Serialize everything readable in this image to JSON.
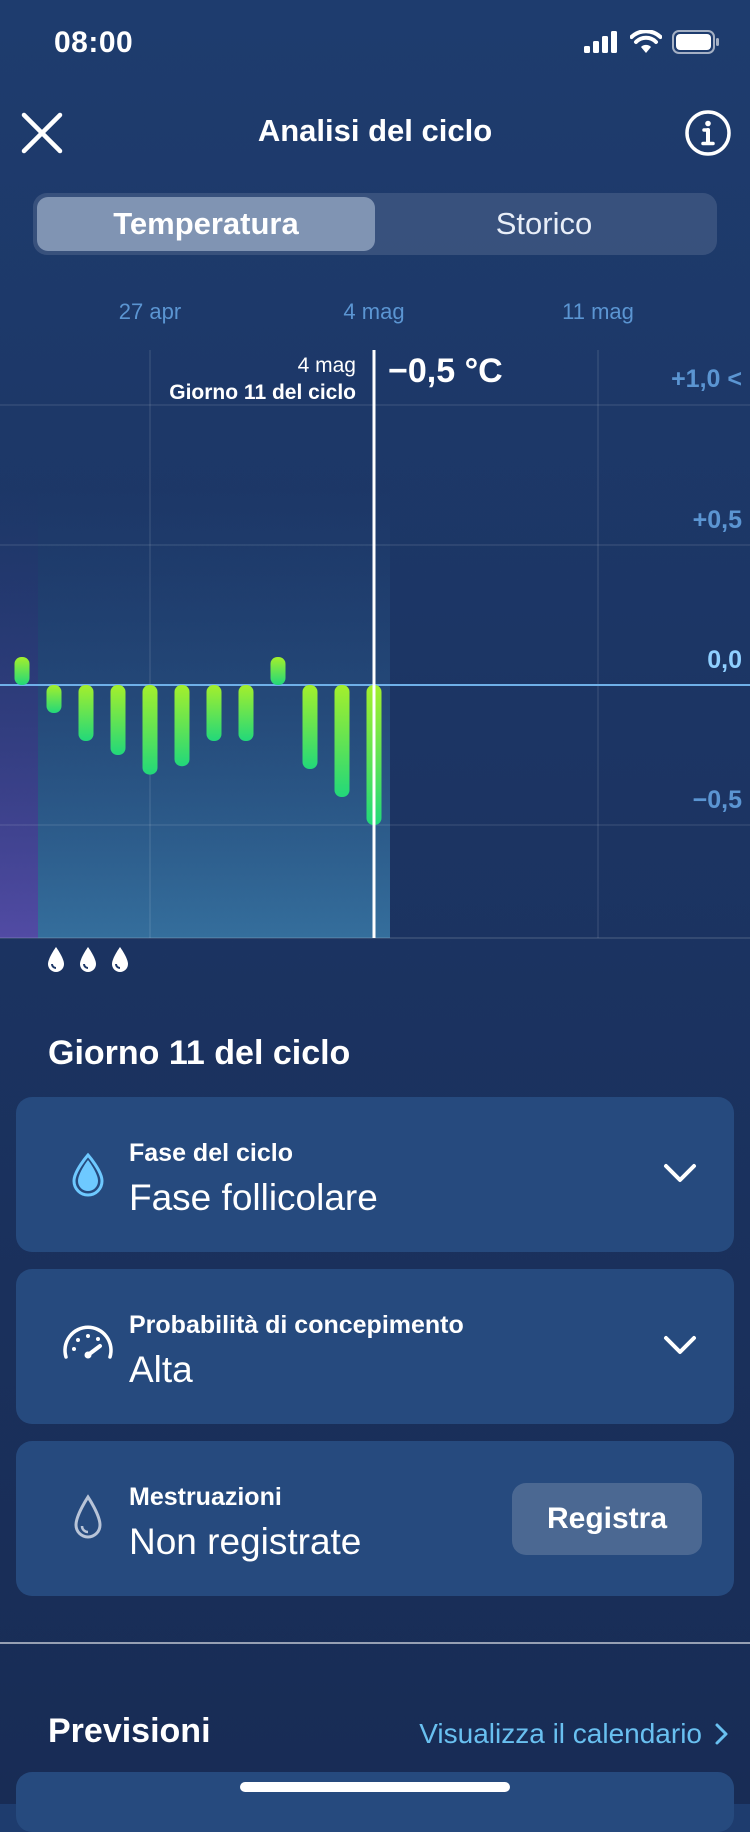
{
  "status": {
    "time": "08:00"
  },
  "nav": {
    "title": "Analisi del ciclo"
  },
  "tabs": [
    {
      "label": "Temperatura",
      "active": true
    },
    {
      "label": "Storico",
      "active": false
    }
  ],
  "chart_data": {
    "type": "bar",
    "title": "",
    "unit": "°C",
    "x_ticks": [
      "27 apr",
      "4 mag",
      "11 mag"
    ],
    "y_ticks": [
      "+1,0",
      "+0,5",
      "0,0",
      "−0,5"
    ],
    "ylim": [
      -0.9,
      1.1
    ],
    "values": [
      0.1,
      -0.1,
      -0.2,
      -0.25,
      -0.32,
      -0.29,
      -0.2,
      -0.2,
      0.1,
      -0.3,
      -0.4,
      -0.5
    ],
    "selected": {
      "date": "4 mag",
      "cycle_day": "Giorno 11 del ciclo",
      "value_label": "−0,5 °C"
    },
    "y_axis_marker": "<",
    "grid": true,
    "colors": {
      "bar_top": "#a4ef2c",
      "bar_bottom": "#22d87a",
      "axis_text": "#5b95d2",
      "zero_line": "#6fb0e8"
    }
  },
  "period_drops": [
    "drop-icon",
    "drop-icon",
    "drop-icon"
  ],
  "day_section": {
    "title": "Giorno 11 del ciclo"
  },
  "cards": {
    "phase": {
      "label": "Fase del ciclo",
      "value": "Fase follicolare",
      "icon": "drop-icon"
    },
    "conception": {
      "label": "Probabilità di concepimento",
      "value": "Alta",
      "icon": "gauge-icon"
    },
    "menstruation": {
      "label": "Mestruazioni",
      "value": "Non registrate",
      "button": "Registra",
      "icon": "drop-outline-icon"
    }
  },
  "predictions": {
    "title": "Previsioni",
    "link": "Visualizza il calendario"
  }
}
